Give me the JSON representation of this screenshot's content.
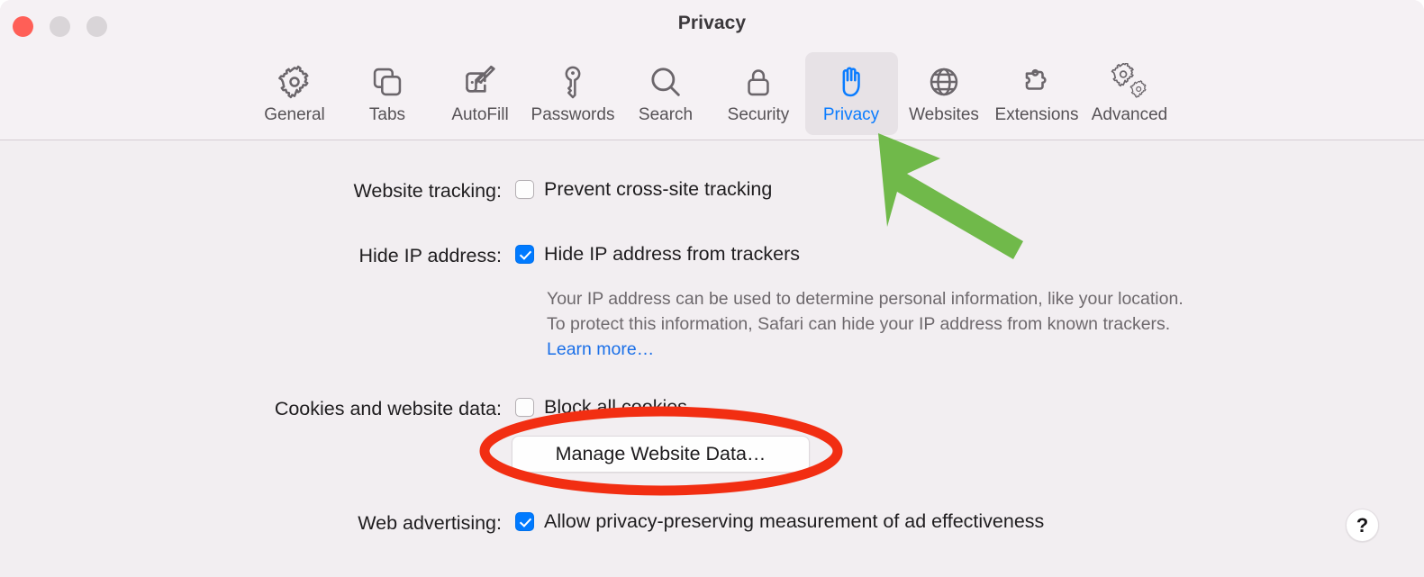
{
  "window": {
    "title": "Privacy",
    "traffic_lights": [
      {
        "name": "close",
        "color": "#ff5f57"
      },
      {
        "name": "minimize",
        "color": "#d9d5d8"
      },
      {
        "name": "maximize",
        "color": "#d9d5d8"
      }
    ]
  },
  "toolbar": {
    "selected": "Privacy",
    "tabs": [
      {
        "label": "General",
        "icon": "gear-icon"
      },
      {
        "label": "Tabs",
        "icon": "tabs-icon"
      },
      {
        "label": "AutoFill",
        "icon": "autofill-icon"
      },
      {
        "label": "Passwords",
        "icon": "key-icon"
      },
      {
        "label": "Search",
        "icon": "search-icon"
      },
      {
        "label": "Security",
        "icon": "lock-icon"
      },
      {
        "label": "Privacy",
        "icon": "hand-icon"
      },
      {
        "label": "Websites",
        "icon": "globe-icon"
      },
      {
        "label": "Extensions",
        "icon": "puzzle-icon"
      },
      {
        "label": "Advanced",
        "icon": "gears-icon"
      }
    ]
  },
  "content": {
    "website_tracking": {
      "label": "Website tracking:",
      "checkbox_label": "Prevent cross-site tracking",
      "checked": false
    },
    "hide_ip": {
      "label": "Hide IP address:",
      "checkbox_label": "Hide IP address from trackers",
      "checked": true,
      "description": "Your IP address can be used to determine personal information, like your location. To protect this information, Safari can hide your IP address from known trackers. ",
      "learn_more": "Learn more…"
    },
    "cookies": {
      "label": "Cookies and website data:",
      "checkbox_label": "Block all cookies",
      "checked": false,
      "manage_button": "Manage Website Data…"
    },
    "web_advertising": {
      "label": "Web advertising:",
      "checkbox_label": "Allow privacy-preserving measurement of ad effectiveness",
      "checked": true
    },
    "help_button": "?"
  },
  "annotations": {
    "arrow": {
      "color": "#70b94a",
      "points_to": "Privacy"
    },
    "highlight_ellipse": {
      "color": "#f22e12",
      "around": "Manage Website Data…"
    }
  },
  "colors": {
    "accent_blue": "#007aff",
    "link_blue": "#1a6fe8",
    "window_bg": "#f2eef1",
    "toolbar_bg": "#f5f1f4",
    "selected_tab_bg": "#e7e2e6",
    "text": "#1f1d1f",
    "muted_text": "#6e696d",
    "annotation_green": "#70b94a",
    "annotation_red": "#f22e12"
  }
}
